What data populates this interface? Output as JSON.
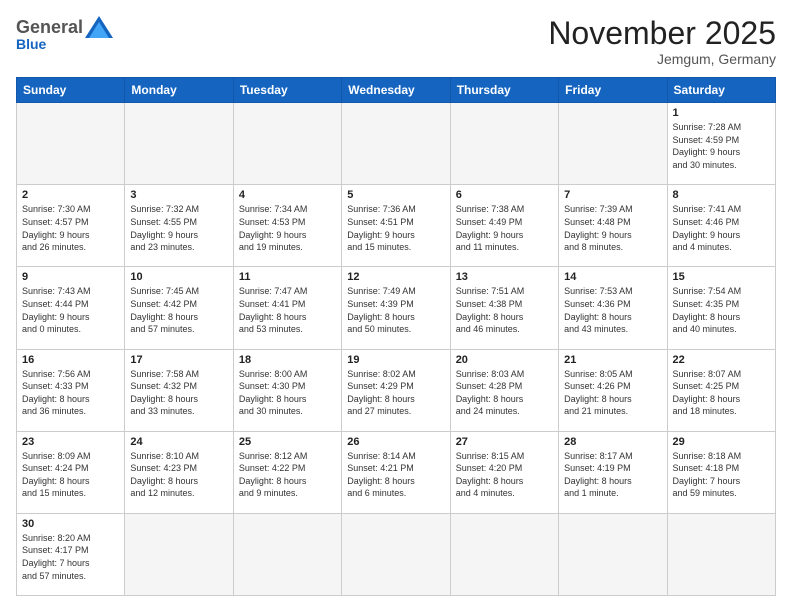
{
  "logo": {
    "general": "General",
    "blue": "Blue"
  },
  "title": "November 2025",
  "location": "Jemgum, Germany",
  "days_header": [
    "Sunday",
    "Monday",
    "Tuesday",
    "Wednesday",
    "Thursday",
    "Friday",
    "Saturday"
  ],
  "weeks": [
    {
      "days": [
        {
          "number": "",
          "info": "",
          "empty": true
        },
        {
          "number": "",
          "info": "",
          "empty": true
        },
        {
          "number": "",
          "info": "",
          "empty": true
        },
        {
          "number": "",
          "info": "",
          "empty": true
        },
        {
          "number": "",
          "info": "",
          "empty": true
        },
        {
          "number": "",
          "info": "",
          "empty": true
        },
        {
          "number": "1",
          "info": "Sunrise: 7:28 AM\nSunset: 4:59 PM\nDaylight: 9 hours\nand 30 minutes."
        }
      ]
    },
    {
      "days": [
        {
          "number": "2",
          "info": "Sunrise: 7:30 AM\nSunset: 4:57 PM\nDaylight: 9 hours\nand 26 minutes."
        },
        {
          "number": "3",
          "info": "Sunrise: 7:32 AM\nSunset: 4:55 PM\nDaylight: 9 hours\nand 23 minutes."
        },
        {
          "number": "4",
          "info": "Sunrise: 7:34 AM\nSunset: 4:53 PM\nDaylight: 9 hours\nand 19 minutes."
        },
        {
          "number": "5",
          "info": "Sunrise: 7:36 AM\nSunset: 4:51 PM\nDaylight: 9 hours\nand 15 minutes."
        },
        {
          "number": "6",
          "info": "Sunrise: 7:38 AM\nSunset: 4:49 PM\nDaylight: 9 hours\nand 11 minutes."
        },
        {
          "number": "7",
          "info": "Sunrise: 7:39 AM\nSunset: 4:48 PM\nDaylight: 9 hours\nand 8 minutes."
        },
        {
          "number": "8",
          "info": "Sunrise: 7:41 AM\nSunset: 4:46 PM\nDaylight: 9 hours\nand 4 minutes."
        }
      ]
    },
    {
      "days": [
        {
          "number": "9",
          "info": "Sunrise: 7:43 AM\nSunset: 4:44 PM\nDaylight: 9 hours\nand 0 minutes."
        },
        {
          "number": "10",
          "info": "Sunrise: 7:45 AM\nSunset: 4:42 PM\nDaylight: 8 hours\nand 57 minutes."
        },
        {
          "number": "11",
          "info": "Sunrise: 7:47 AM\nSunset: 4:41 PM\nDaylight: 8 hours\nand 53 minutes."
        },
        {
          "number": "12",
          "info": "Sunrise: 7:49 AM\nSunset: 4:39 PM\nDaylight: 8 hours\nand 50 minutes."
        },
        {
          "number": "13",
          "info": "Sunrise: 7:51 AM\nSunset: 4:38 PM\nDaylight: 8 hours\nand 46 minutes."
        },
        {
          "number": "14",
          "info": "Sunrise: 7:53 AM\nSunset: 4:36 PM\nDaylight: 8 hours\nand 43 minutes."
        },
        {
          "number": "15",
          "info": "Sunrise: 7:54 AM\nSunset: 4:35 PM\nDaylight: 8 hours\nand 40 minutes."
        }
      ]
    },
    {
      "days": [
        {
          "number": "16",
          "info": "Sunrise: 7:56 AM\nSunset: 4:33 PM\nDaylight: 8 hours\nand 36 minutes."
        },
        {
          "number": "17",
          "info": "Sunrise: 7:58 AM\nSunset: 4:32 PM\nDaylight: 8 hours\nand 33 minutes."
        },
        {
          "number": "18",
          "info": "Sunrise: 8:00 AM\nSunset: 4:30 PM\nDaylight: 8 hours\nand 30 minutes."
        },
        {
          "number": "19",
          "info": "Sunrise: 8:02 AM\nSunset: 4:29 PM\nDaylight: 8 hours\nand 27 minutes."
        },
        {
          "number": "20",
          "info": "Sunrise: 8:03 AM\nSunset: 4:28 PM\nDaylight: 8 hours\nand 24 minutes."
        },
        {
          "number": "21",
          "info": "Sunrise: 8:05 AM\nSunset: 4:26 PM\nDaylight: 8 hours\nand 21 minutes."
        },
        {
          "number": "22",
          "info": "Sunrise: 8:07 AM\nSunset: 4:25 PM\nDaylight: 8 hours\nand 18 minutes."
        }
      ]
    },
    {
      "days": [
        {
          "number": "23",
          "info": "Sunrise: 8:09 AM\nSunset: 4:24 PM\nDaylight: 8 hours\nand 15 minutes."
        },
        {
          "number": "24",
          "info": "Sunrise: 8:10 AM\nSunset: 4:23 PM\nDaylight: 8 hours\nand 12 minutes."
        },
        {
          "number": "25",
          "info": "Sunrise: 8:12 AM\nSunset: 4:22 PM\nDaylight: 8 hours\nand 9 minutes."
        },
        {
          "number": "26",
          "info": "Sunrise: 8:14 AM\nSunset: 4:21 PM\nDaylight: 8 hours\nand 6 minutes."
        },
        {
          "number": "27",
          "info": "Sunrise: 8:15 AM\nSunset: 4:20 PM\nDaylight: 8 hours\nand 4 minutes."
        },
        {
          "number": "28",
          "info": "Sunrise: 8:17 AM\nSunset: 4:19 PM\nDaylight: 8 hours\nand 1 minute."
        },
        {
          "number": "29",
          "info": "Sunrise: 8:18 AM\nSunset: 4:18 PM\nDaylight: 7 hours\nand 59 minutes."
        }
      ]
    },
    {
      "days": [
        {
          "number": "30",
          "info": "Sunrise: 8:20 AM\nSunset: 4:17 PM\nDaylight: 7 hours\nand 57 minutes."
        },
        {
          "number": "",
          "info": "",
          "empty": true
        },
        {
          "number": "",
          "info": "",
          "empty": true
        },
        {
          "number": "",
          "info": "",
          "empty": true
        },
        {
          "number": "",
          "info": "",
          "empty": true
        },
        {
          "number": "",
          "info": "",
          "empty": true
        },
        {
          "number": "",
          "info": "",
          "empty": true
        }
      ]
    }
  ]
}
